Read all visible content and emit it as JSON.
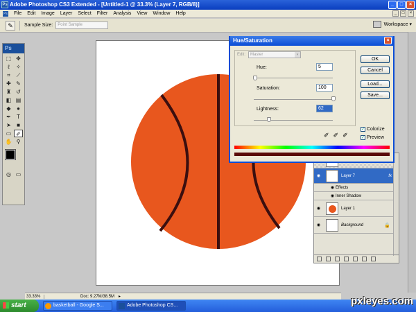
{
  "window": {
    "title": "Adobe Photoshop CS3 Extended - [Untitled-1 @ 33.3% (Layer 7, RGB/8)]",
    "buttons": [
      "_",
      "□",
      "×"
    ]
  },
  "menubar": {
    "items": [
      "File",
      "Edit",
      "Image",
      "Layer",
      "Select",
      "Filter",
      "Analysis",
      "View",
      "Window",
      "Help"
    ]
  },
  "options": {
    "sample_size_label": "Sample Size:",
    "sample_size_value": "Point Sample",
    "workspace_label": "Workspace ▾"
  },
  "toolbox": {
    "logo": "Ps"
  },
  "document": {
    "zoom": "33.33%",
    "doc_size": "Doc: 9.27M/38.5M",
    "ball_color": "#e8571e",
    "seam_color": "#3b0f0f"
  },
  "dialog": {
    "title": "Hue/Saturation",
    "edit_label": "Edit:",
    "edit_value": "Master",
    "hue_label": "Hue:",
    "hue_value": "5",
    "saturation_label": "Saturation:",
    "saturation_value": "100",
    "lightness_label": "Lightness:",
    "lightness_value": "62",
    "ok_label": "OK",
    "cancel_label": "Cancel",
    "load_label": "Load...",
    "save_label": "Save...",
    "colorize_label": "Colorize",
    "preview_label": "Preview",
    "colorize_checked": true,
    "preview_checked": true
  },
  "layers": {
    "items": [
      {
        "name": "Layer 7",
        "selected": true
      },
      {
        "name": "Effects"
      },
      {
        "name": "Inner Shadow"
      },
      {
        "name": "Layer 1"
      },
      {
        "name": "Background",
        "locked": true
      }
    ]
  },
  "taskbar": {
    "start_label": "start",
    "tasks": [
      "basketball - Google S...",
      "Adobe Photoshop CS..."
    ]
  },
  "watermark": "pxleyes.com"
}
